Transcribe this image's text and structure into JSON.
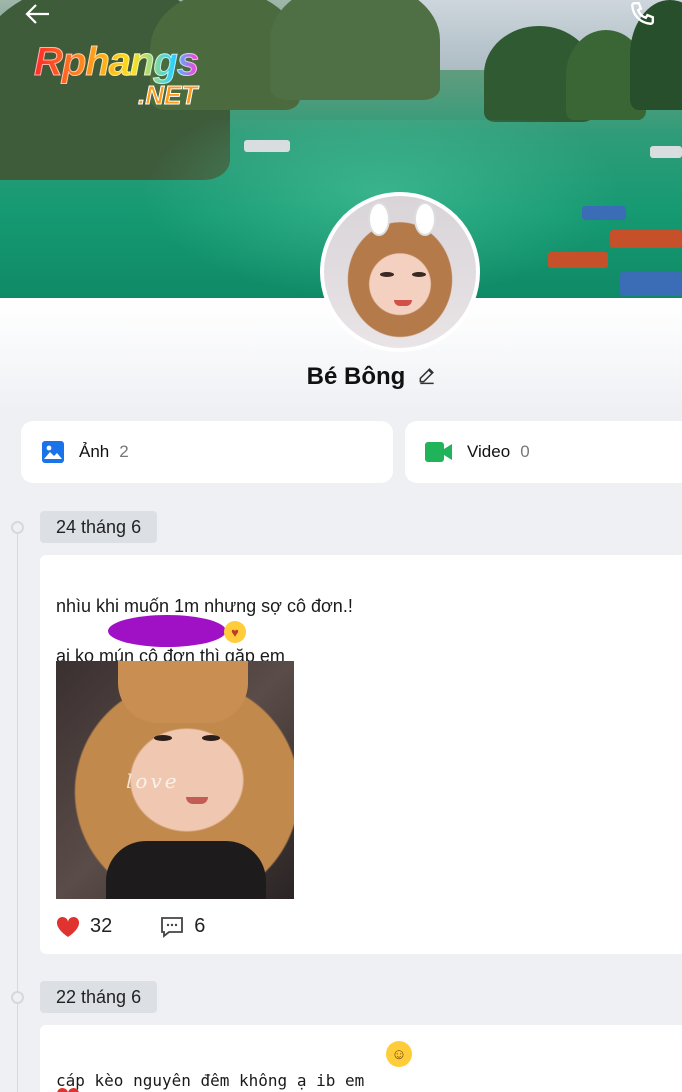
{
  "colors": {
    "accent_blue": "#1a73e8",
    "video_green": "#21b35a",
    "heart_red": "#e0322e",
    "redaction_purple": "#a011c6"
  },
  "header": {
    "back_icon": "arrow-left-icon",
    "call_icon": "phone-icon"
  },
  "watermark": {
    "main": "Rphangs",
    "sub": ".NET"
  },
  "profile": {
    "name": "Bé Bông",
    "edit_icon": "pencil-icon"
  },
  "media": [
    {
      "label": "Ảnh",
      "count": "2",
      "icon": "image-icon"
    },
    {
      "label": "Video",
      "count": "0",
      "icon": "video-camera-icon"
    }
  ],
  "posts": [
    {
      "date": "24 tháng 6",
      "line1": "nhìu khi muốn 1m nhưng sợ cô đơn.!",
      "line2": "ai ko mún cô đơn thì gặp em",
      "line3_prefix": "..",
      "photo_caption": "love",
      "likes": "32",
      "comments": "6"
    },
    {
      "date": "22 tháng 6",
      "text": "cáp kèo nguyên đêm không ạ ib em"
    }
  ]
}
